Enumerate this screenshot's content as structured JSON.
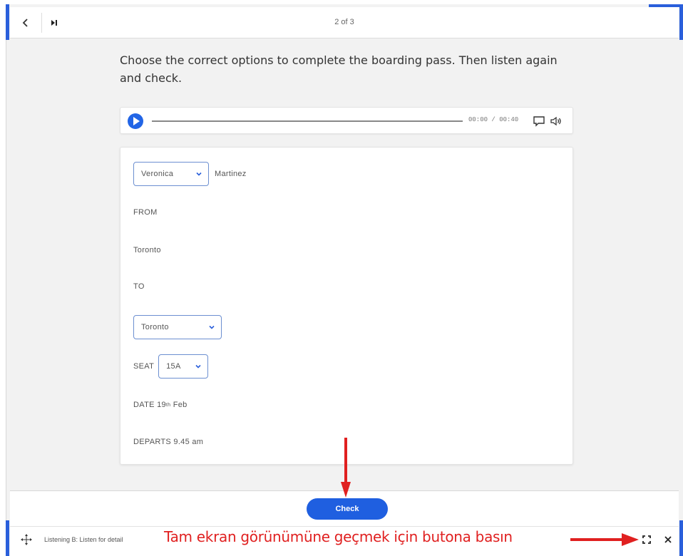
{
  "topbar": {
    "page_count": "2 of 3"
  },
  "instructions": "Choose the correct options to complete the boarding pass. Then listen again and check.",
  "audio": {
    "time": "00:00 / 00:40"
  },
  "form": {
    "first_name_value": "Veronica",
    "last_name": "Martinez",
    "from_label": "FROM",
    "from_value": "Toronto",
    "to_label": "TO",
    "to_value": "Toronto",
    "seat_label": "SEAT",
    "seat_value": "15A",
    "date_prefix": "DATE 19",
    "date_sup": "th",
    "date_suffix": " Feb",
    "departs": "DEPARTS 9.45 am"
  },
  "check_label": "Check",
  "footer": {
    "activity_label": "Listening B: Listen for detail",
    "annotation": "Tam ekran görünümüne geçmek için butona basın"
  },
  "colors": {
    "accent": "#1f5fe0",
    "annotation": "#e02020",
    "frame_corner": "#2a5fdb"
  },
  "icons": [
    "back-icon",
    "skip-icon",
    "play-icon",
    "transcript-icon",
    "volume-icon",
    "chevron-down-icon",
    "move-icon",
    "fullscreen-icon",
    "close-icon"
  ]
}
